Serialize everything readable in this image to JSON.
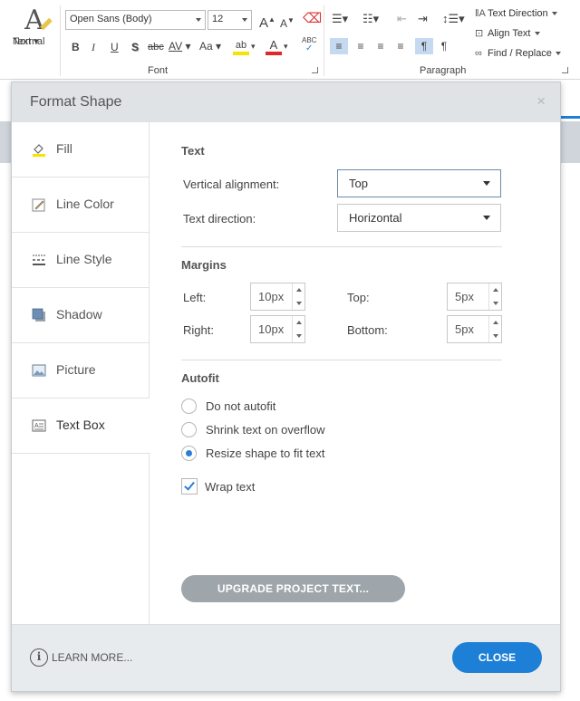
{
  "ribbon": {
    "normal_text": "Normal\nText",
    "normal_text_line1": "Normal",
    "normal_text_line2": "Text",
    "font_name": "Open Sans (Body)",
    "font_size": "12",
    "font_group_label": "Font",
    "paragraph_group_label": "Paragraph",
    "text_direction": "Text Direction",
    "align_text": "Align Text",
    "find_replace": "Find / Replace",
    "buttons": {
      "bold": "B",
      "italic": "I",
      "underline": "U",
      "shadow": "S",
      "strike": "abc",
      "spacing": "AV",
      "case": "Aa",
      "grow": "A",
      "shrink": "A",
      "spell": "ABC"
    },
    "colors": {
      "highlight": "#f5e400",
      "font_color": "#e0282a",
      "active_bg": "#c5daf0"
    }
  },
  "dialog": {
    "title": "Format Shape",
    "close_glyph": "×",
    "sidebar": [
      {
        "label": "Fill",
        "icon": "fill-bucket-icon"
      },
      {
        "label": "Line Color",
        "icon": "pencil-icon"
      },
      {
        "label": "Line Style",
        "icon": "line-style-icon"
      },
      {
        "label": "Shadow",
        "icon": "shadow-icon"
      },
      {
        "label": "Picture",
        "icon": "picture-icon"
      },
      {
        "label": "Text Box",
        "icon": "text-box-icon",
        "active": true
      }
    ],
    "text_section": {
      "title": "Text",
      "vertical_alignment_label": "Vertical alignment:",
      "vertical_alignment_value": "Top",
      "text_direction_label": "Text direction:",
      "text_direction_value": "Horizontal"
    },
    "margins": {
      "title": "Margins",
      "left_label": "Left:",
      "left_value": "10px",
      "right_label": "Right:",
      "right_value": "10px",
      "top_label": "Top:",
      "top_value": "5px",
      "bottom_label": "Bottom:",
      "bottom_value": "5px"
    },
    "autofit": {
      "title": "Autofit",
      "options": [
        {
          "label": "Do not autofit",
          "selected": false
        },
        {
          "label": "Shrink text on overflow",
          "selected": false
        },
        {
          "label": "Resize shape to fit text",
          "selected": true
        }
      ],
      "wrap_text_label": "Wrap text",
      "wrap_text_checked": true
    },
    "upgrade_button": "UPGRADE PROJECT TEXT...",
    "learn_more": "LEARN MORE...",
    "close_button": "CLOSE",
    "colors": {
      "primary": "#1e7fd6",
      "disabled_button": "#9ea5ab",
      "header_bg": "#dfe3e6"
    }
  }
}
